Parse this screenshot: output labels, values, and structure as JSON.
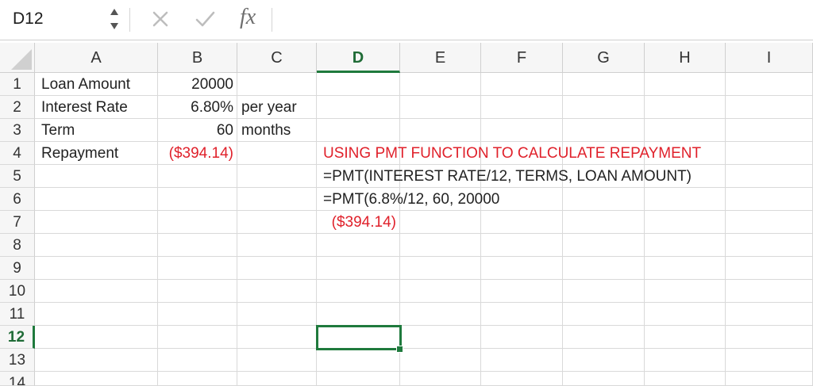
{
  "formula_bar": {
    "name_box": "D12",
    "fx_label": "fx",
    "formula_value": "",
    "cancel_icon": "close-icon",
    "confirm_icon": "check-icon"
  },
  "columns": [
    "A",
    "B",
    "C",
    "D",
    "E",
    "F",
    "G",
    "H",
    "I"
  ],
  "selected_column": "D",
  "rows": [
    "1",
    "2",
    "3",
    "4",
    "5",
    "6",
    "7",
    "8",
    "9",
    "10",
    "11",
    "12",
    "13",
    "14"
  ],
  "selected_row": "12",
  "cells": {
    "A1": "Loan Amount",
    "B1": "20000",
    "A2": "Interest Rate",
    "B2": "6.80%",
    "C2": "per year",
    "A3": "Term",
    "B3": "60",
    "C3": "months",
    "A4": "Repayment",
    "B4": "($394.14)",
    "D4": "USING PMT FUNCTION TO CALCULATE REPAYMENT",
    "D5": "=PMT(INTEREST RATE/12, TERMS, LOAN AMOUNT)",
    "D6": "=PMT(6.8%/12, 60, 20000",
    "D7": "($394.14)"
  },
  "colors": {
    "accent_green": "#1f7a3d",
    "negative_red": "#e0212b"
  }
}
